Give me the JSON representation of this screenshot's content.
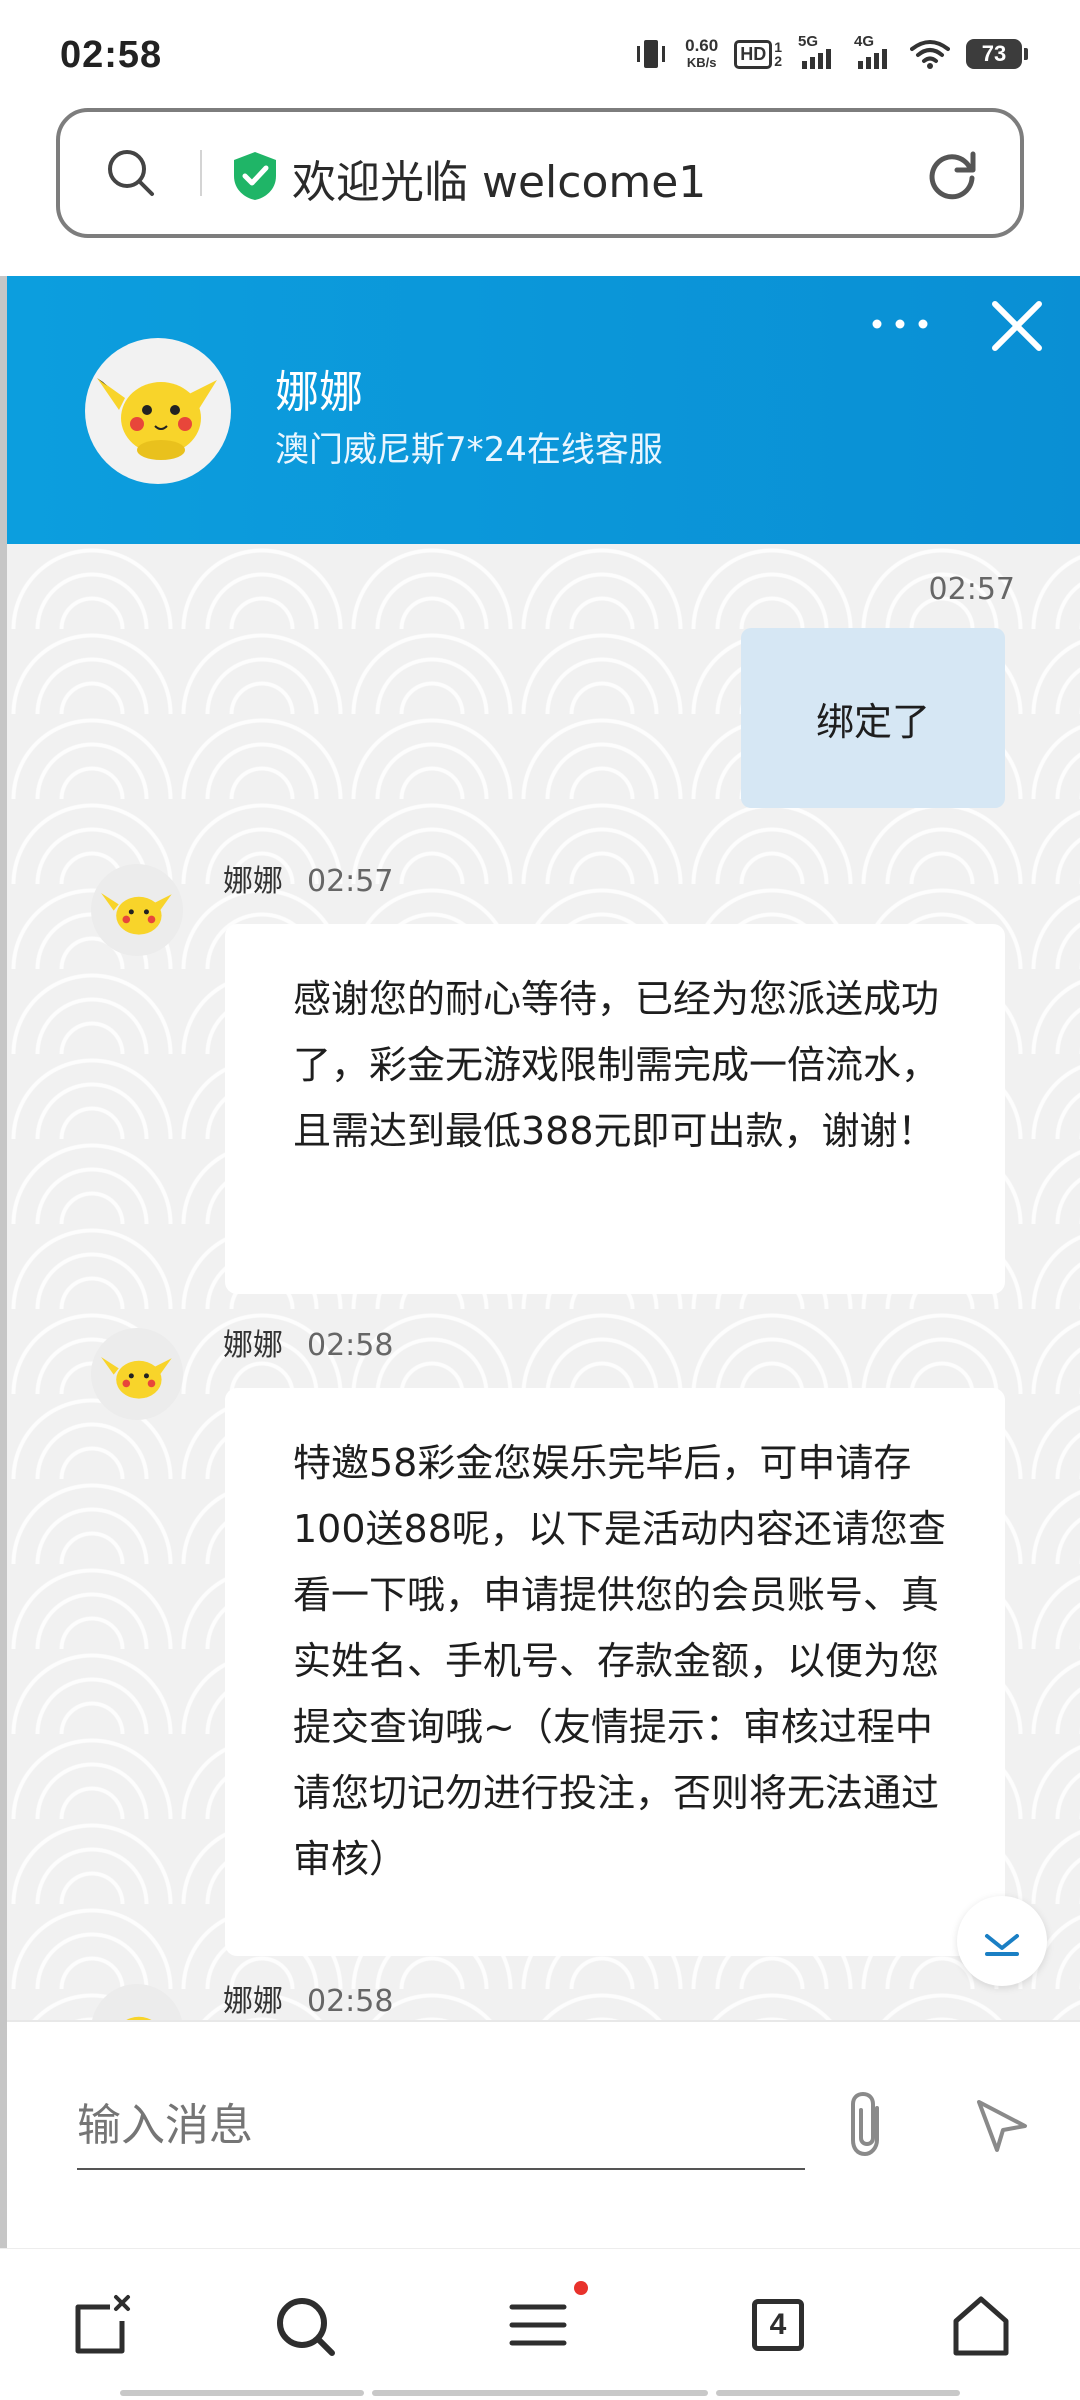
{
  "status_bar": {
    "time": "02:58",
    "net_speed_value": "0.60",
    "net_speed_unit": "KB/s",
    "hd_label": "HD",
    "sim_labels": [
      "1",
      "2"
    ],
    "signal_1": "5G",
    "signal_2": "4G",
    "battery": "73"
  },
  "url_bar": {
    "text": "欢迎光临 welcome1"
  },
  "chat_header": {
    "agent_name": "娜娜",
    "agent_subtitle": "澳门威尼斯7*24在线客服",
    "accent_color": "#0a98da"
  },
  "messages": [
    {
      "direction": "out",
      "time": "02:57",
      "text": "绑定了"
    },
    {
      "direction": "in",
      "sender": "娜娜",
      "time": "02:57",
      "text": "感谢您的耐心等待，已经为您派送成功了，彩金无游戏限制需完成一倍流水，且需达到最低388元即可出款，谢谢！"
    },
    {
      "direction": "in",
      "sender": "娜娜",
      "time": "02:58",
      "text": "特邀58彩金您娱乐完毕后，可申请存100送88呢，以下是活动内容还请您查看一下哦，申请提供您的会员账号、真实姓名、手机号、存款金额，以便为您提交查询哦~（友情提示：审核过程中请您切记勿进行投注，否则将无法通过审核）"
    },
    {
      "direction": "in",
      "sender": "娜娜",
      "time": "02:58",
      "text": ""
    }
  ],
  "input": {
    "placeholder": "输入消息"
  },
  "bottom_nav": {
    "tabs_count": "4",
    "icons": [
      "close-tab-icon",
      "search-icon",
      "menu-icon",
      "tabs-icon",
      "home-icon"
    ]
  }
}
